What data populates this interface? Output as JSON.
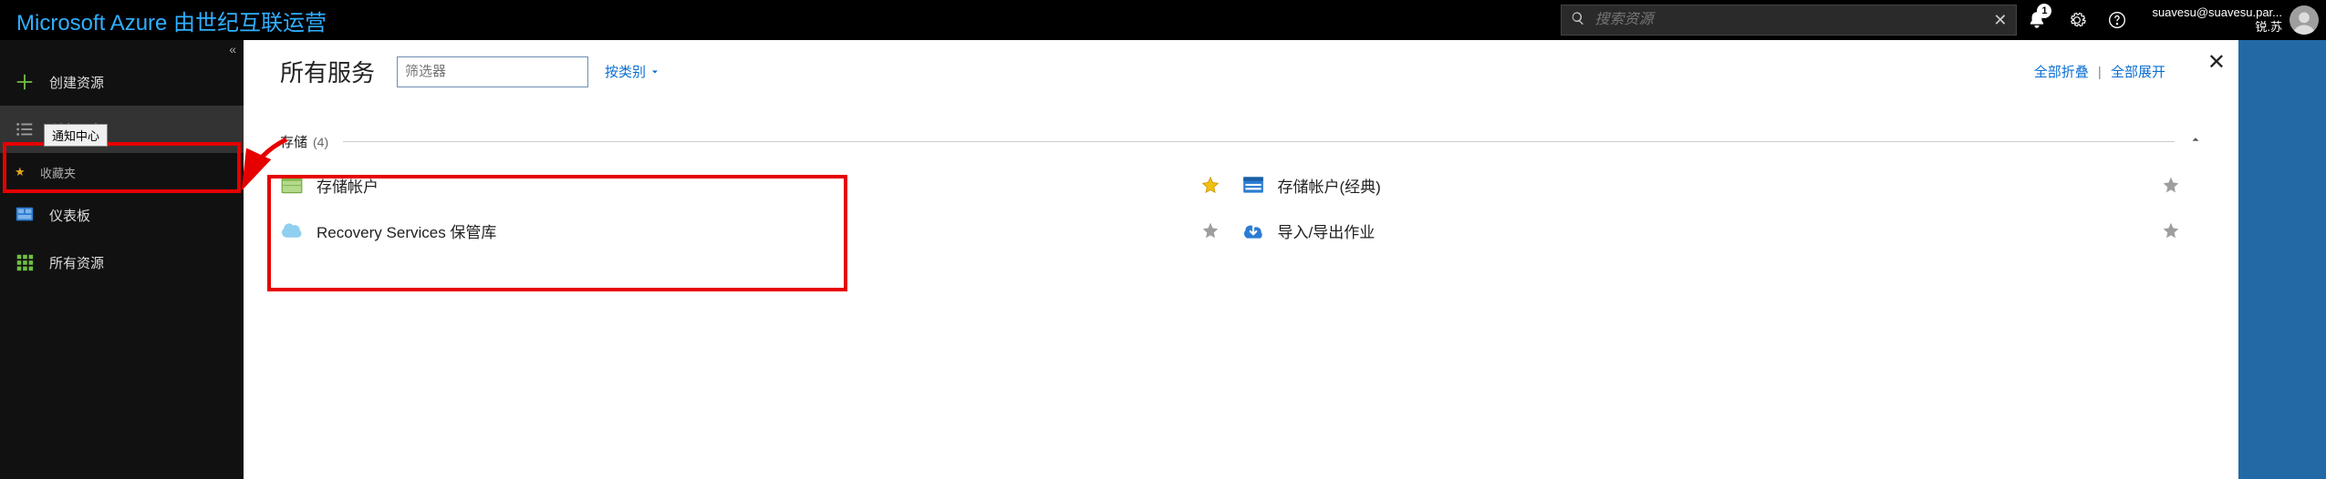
{
  "header": {
    "brand": "Microsoft Azure 由世纪互联运营",
    "search_placeholder": "搜索资源",
    "notification_count": "1",
    "user_email": "suavesu@suavesu.par...",
    "user_name": "锐.苏"
  },
  "sidebar": {
    "tooltip": "通知中心",
    "items": {
      "create": "创建资源",
      "all_services": "所有服务",
      "favorites_header": "收藏夹",
      "dashboard": "仪表板",
      "all_resources": "所有资源"
    }
  },
  "blade": {
    "title": "所有服务",
    "filter_placeholder": "筛选器",
    "by_category": "按类别",
    "collapse_all": "全部折叠",
    "expand_all": "全部展开"
  },
  "category": {
    "name": "存储",
    "count": "(4)"
  },
  "services": [
    {
      "label": "存储帐户",
      "icon": "storage-account-icon",
      "starred": true
    },
    {
      "label": "存储帐户(经典)",
      "icon": "storage-account-classic-icon",
      "starred": false
    },
    {
      "label": "Recovery Services 保管库",
      "icon": "recovery-services-vault-icon",
      "starred": false
    },
    {
      "label": "导入/导出作业",
      "icon": "import-export-job-icon",
      "starred": false
    }
  ]
}
